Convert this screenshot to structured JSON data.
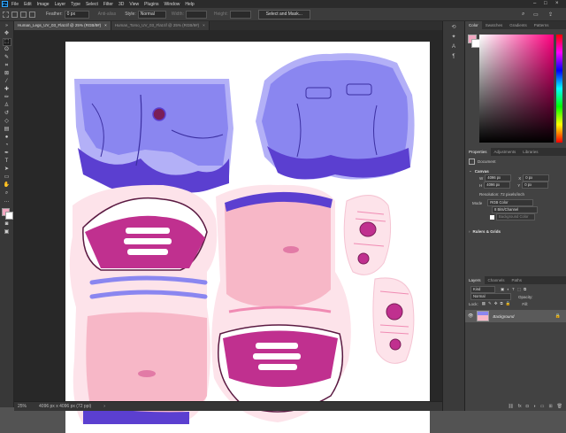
{
  "menu": {
    "app_icon": "Ps",
    "items": [
      "File",
      "Edit",
      "Image",
      "Layer",
      "Type",
      "Select",
      "Filter",
      "3D",
      "View",
      "Plugins",
      "Window",
      "Help"
    ]
  },
  "options": {
    "feather_label": "Feather:",
    "feather_value": "0 px",
    "antialias_label": "Anti-alias",
    "style_label": "Style:",
    "style_value": "Normal",
    "width_label": "Width:",
    "height_label": "Height:",
    "select_mask_label": "Select and Mask..."
  },
  "tabs": [
    {
      "label": "Human_Legs_UV_03_Flat.tif @ 25% (RGB/8#)",
      "close": "×"
    },
    {
      "label": "Human_Torso_UV_03_Flat.tif @ 25% (RGB/8#)",
      "close": "×"
    }
  ],
  "status": {
    "zoom": "25%",
    "doc_size": "4096 px x 4096 px (72 ppi)",
    "arrow": "›"
  },
  "color_panel": {
    "tabs": [
      "Color",
      "Swatches",
      "Gradients",
      "Patterns"
    ]
  },
  "properties_panel": {
    "tabs": [
      "Properties",
      "Adjustments",
      "Libraries"
    ],
    "doc_label": "Document",
    "canvas_title": "Canvas",
    "w_label": "W",
    "w_value": "4096 px",
    "h_label": "H",
    "h_value": "4096 px",
    "x_label": "X",
    "x_value": "0 px",
    "y_label": "Y",
    "y_value": "0 px",
    "resolution": "Resolution: 72 pixels/inch",
    "mode_label": "Mode",
    "mode_value": "RGB Color",
    "depth_value": "8 Bits/Channel",
    "bg_label": "Background Color",
    "rulers_title": "Rulers & Grids"
  },
  "layers_panel": {
    "tabs": [
      "Layers",
      "Channels",
      "Paths"
    ],
    "kind_placeholder": "Kind",
    "blend_mode": "Normal",
    "opacity_label": "Opacity:",
    "lock_label": "Lock:",
    "fill_label": "Fill:",
    "layer_name": "Background"
  },
  "colors": {
    "shorts": "#8a86f0",
    "shorts_dark": "#5b3fd0",
    "shorts_light": "#b3b0f7",
    "skin": "#f7b7c7",
    "skin_light": "#fde3ea",
    "magenta": "#c0308f",
    "magenta_dark": "#7a1e58"
  }
}
